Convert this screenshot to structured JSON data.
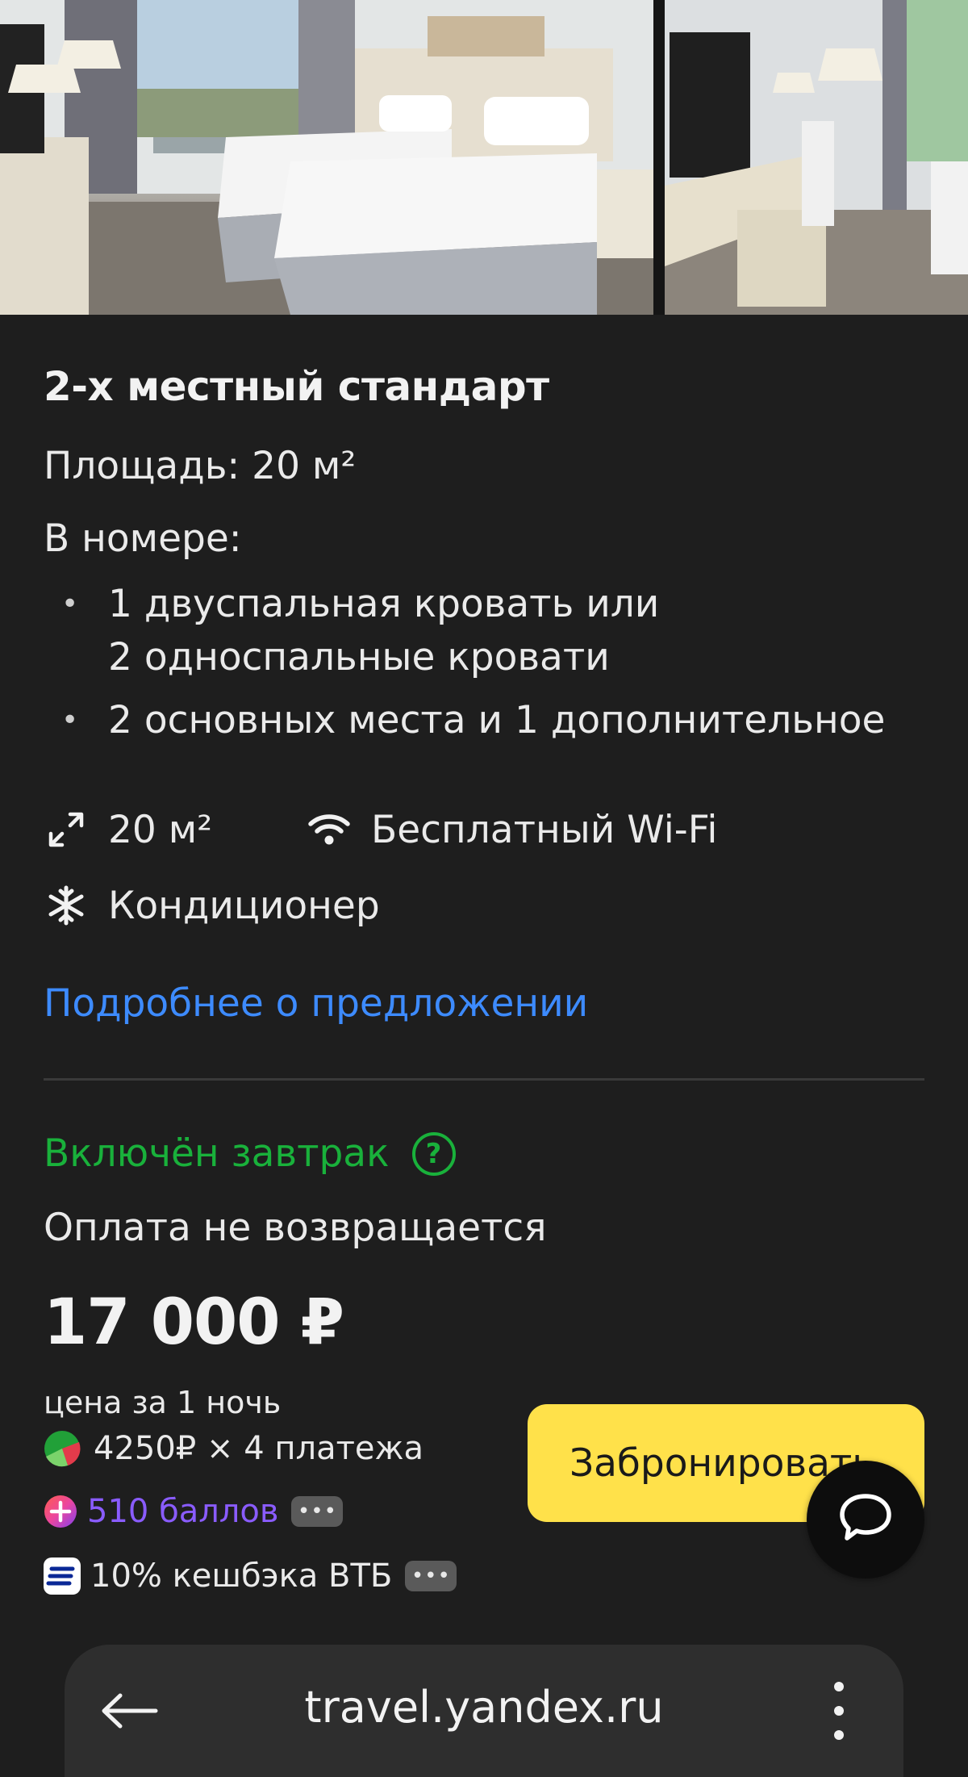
{
  "room": {
    "title": "2-х местный стандарт",
    "area_label": "Площадь: 20 м²",
    "in_room_label": "В номере:",
    "features": [
      "1 двуспальная кровать или\n2 односпальные кровати",
      "2 основных места и 1 дополнительное"
    ]
  },
  "amenities": {
    "area": "20 м²",
    "wifi": "Бесплатный Wi-Fi",
    "ac": "Кондиционер"
  },
  "details_link": "Подробнее о предложении",
  "offer": {
    "meal": "Включён завтрак",
    "refund": "Оплата не возвращается",
    "price": "17 000 ₽",
    "price_note": "цена за 1 ночь",
    "installments": "4250₽ × 4 платежа",
    "points": "510 баллов",
    "cashback": "10% кешбэка ВТБ",
    "book_label": "Забронировать"
  },
  "browser": {
    "url": "travel.yandex.ru"
  },
  "colors": {
    "link": "#3d8bff",
    "meal": "#19b13b",
    "points": "#8a5cff",
    "book_button": "#ffe14a",
    "background": "#1e1e1e"
  },
  "icons": {
    "area": "expand-icon",
    "wifi": "wifi-icon",
    "ac": "snowflake-icon",
    "help": "question-icon",
    "installments": "split-payment-icon",
    "points": "plus-points-icon",
    "cashback": "vtb-icon",
    "chat": "chat-icon",
    "back": "back-arrow-icon",
    "menu": "more-vertical-icon"
  }
}
